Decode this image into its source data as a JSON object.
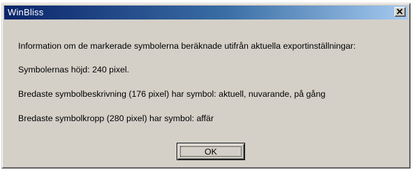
{
  "window": {
    "title": "WinBliss",
    "close_icon": "close-icon"
  },
  "message": {
    "line1": "Information om de markerade symbolerna beräknade utifrån aktuella exportinställningar:",
    "line2": "Symbolernas höjd: 240 pixel.",
    "line3": "Bredaste symbolbeskrivning (176 pixel) har symbol: aktuell, nuvarande, på gång",
    "line4": "Bredaste symbolkropp (280 pixel) har symbol: affär"
  },
  "buttons": {
    "ok_label": "OK"
  },
  "colors": {
    "title_start": "#0a246a",
    "title_end": "#a6caf0",
    "face": "#d4d0c8"
  }
}
